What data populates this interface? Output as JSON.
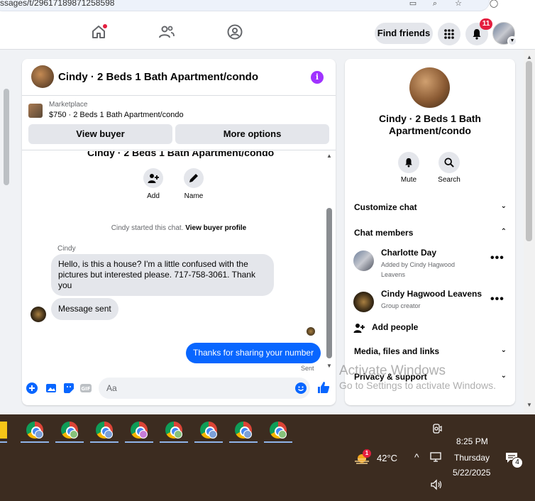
{
  "browser": {
    "url_fragment": "ssages/t/29617189871258598"
  },
  "nav": {
    "find_friends": "Find friends",
    "notification_count": "11"
  },
  "chat": {
    "title": "Cindy · 2 Beds 1 Bath Apartment/condo",
    "marketplace_label": "Marketplace",
    "listing": "$750 · 2 Beds 1 Bath Apartment/condo",
    "view_buyer": "View buyer",
    "more_options": "More options",
    "conversation_title": "Cindy · 2 Beds 1 Bath Apartment/condo",
    "actions": [
      {
        "label": "Add"
      },
      {
        "label": "Name"
      }
    ],
    "started_text": "Cindy started this chat.",
    "view_profile": "View buyer profile",
    "sender": "Cindy",
    "incoming_1": "Hello, is this a house?  I'm a little confused with the pictures but interested please.  717-758-3061. Thank you",
    "incoming_2": "Message sent",
    "outgoing_1": "Thanks for sharing your number",
    "sent_label": "Sent",
    "composer_placeholder": "Aa"
  },
  "details": {
    "name": "Cindy · 2 Beds 1 Bath Apartment/condo",
    "mute": "Mute",
    "search": "Search",
    "customize_chat": "Customize chat",
    "chat_members": "Chat members",
    "members": [
      {
        "name": "Charlotte Day",
        "subtitle": "Added by Cindy Hagwood Leavens"
      },
      {
        "name": "Cindy Hagwood Leavens",
        "subtitle": "Group creator"
      }
    ],
    "add_people": "Add people",
    "media_files_links": "Media, files and links",
    "privacy_support": "Privacy & support"
  },
  "watermark": {
    "line1": "Activate Windows",
    "line2": "Go to Settings to activate Windows."
  },
  "taskbar": {
    "weather_alert": "1",
    "temperature": "42°C",
    "time": "8:25 PM",
    "day": "Thursday",
    "date": "5/22/2025",
    "notifications": "4"
  }
}
